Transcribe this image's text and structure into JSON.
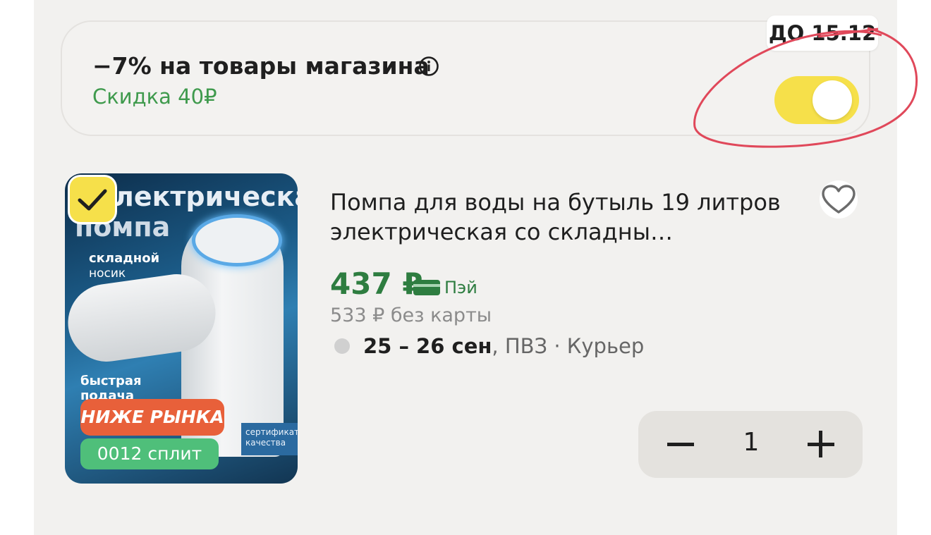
{
  "promo": {
    "title": "−7% на товары магазина",
    "discount": "Скидка 40₽",
    "until_badge": "ДО 15.12",
    "toggle_on": true
  },
  "product": {
    "image": {
      "heading_line1": "лектрическая",
      "heading_line2": "помпа",
      "caption_folding": "складной",
      "caption_spout": "носик",
      "caption_fast_line1": "быстрая",
      "caption_fast_line2": "подача",
      "certificate_line1": "сертификат",
      "certificate_line2": "качества"
    },
    "selected": true,
    "badge_below_market": "НИЖЕ РЫНКА",
    "badge_split": "0012 сплит",
    "title": "Помпа для воды на бутыль 19 литров электрическая со складны…",
    "price": "437 ₽",
    "pay_label": "Пэй",
    "old_price": "533 ₽  без карты",
    "delivery_dates": "25 – 26 сен",
    "delivery_rest": ", ПВЗ · Курьер",
    "quantity": "1"
  },
  "colors": {
    "toggle": "#f6e04a",
    "price_green": "#2e7d40",
    "discount_green": "#3f9a4d",
    "annotation_red": "#e0485a",
    "badge_orange": "#e8603a",
    "badge_green": "#4fbf7a"
  },
  "icons": {
    "info": "info-icon",
    "favorite": "heart-icon",
    "checkbox": "check-icon",
    "card": "card-icon"
  }
}
